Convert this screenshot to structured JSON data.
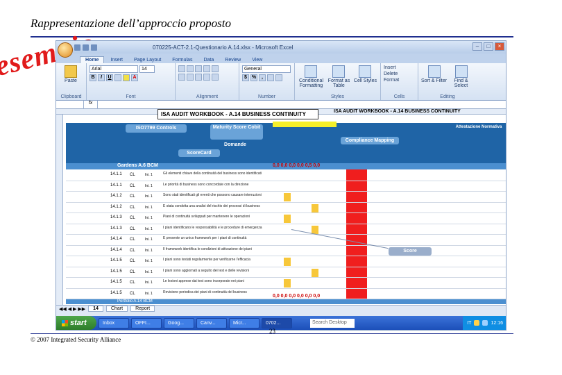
{
  "slide": {
    "title": "Rappresentazione dell’approccio proposto",
    "stamp": "esempio",
    "copyright": "© 2007 Integrated Security Alliance",
    "page_number": "23",
    "accent_color": "#e11b1b",
    "rule_color": "#1f2f8f"
  },
  "excel": {
    "window_title": "070225-ACT-2.1-Questionario A.14.xlsx - Microsoft Excel",
    "tabs": [
      "Home",
      "Insert",
      "Page Layout",
      "Formulas",
      "Data",
      "Review",
      "View"
    ],
    "active_tab": "Home",
    "ribbon": {
      "clipboard": {
        "paste": "Paste",
        "label": "Clipboard"
      },
      "font": {
        "font_name": "Arial",
        "font_size": "14",
        "label": "Font"
      },
      "alignment": {
        "label": "Alignment"
      },
      "number": {
        "format": "General",
        "label": "Number"
      },
      "styles": {
        "conditional": "Conditional Formatting",
        "format_table": "Format as Table",
        "cell_styles": "Cell Styles",
        "label": "Styles"
      },
      "cells": {
        "insert": "Insert",
        "delete": "Delete",
        "format": "Format",
        "label": "Cells"
      },
      "editing": {
        "sort": "Sort & Filter",
        "find": "Find & Select",
        "label": "Editing"
      }
    },
    "sheet": {
      "banner": "ISA AUDIT WORKBOOK - A.14 BUSINESS CONTINUITY",
      "banner2": "ISA AUDIT WORKBOOK - A.14 BUSINESS CONTINUITY",
      "yellow_strip": "Maturity Score Area",
      "section_header": "Gardens A.6 BCM",
      "bottom_bar": "Portfolio A.14 BCM",
      "overlays": {
        "controls": "ISO7799 Controls",
        "maturity": "Maturity Score Cobit",
        "domande": "Domande",
        "scorecard": "ScoreCard",
        "compliance": "Compliance Mapping",
        "attestazione": "Attestazione Normativa"
      },
      "score_row_top": "0,0 0,0 0,0 0,0 0,5 0,0",
      "score_row_bottom": "0,0 0,0 0,0 0,0 0,0 0,0",
      "rows": [
        {
          "id": "14.1.1",
          "ref": "CL",
          "type": "Ini. 1",
          "text": "Gli elementi chiave della continuità del business sono identificati"
        },
        {
          "id": "14.1.1",
          "ref": "CL",
          "type": "Ini. 1",
          "text": "Le priorità di business sono concordate con la direzione"
        },
        {
          "id": "14.1.2",
          "ref": "CL",
          "type": "Ini. 1",
          "text": "Sono stati identificati gli eventi che possono causare interruzioni"
        },
        {
          "id": "14.1.2",
          "ref": "CL",
          "type": "Ini. 1",
          "text": "È stata condotta una analisi del rischio dei processi di business"
        },
        {
          "id": "14.1.3",
          "ref": "CL",
          "type": "Ini. 1",
          "text": "Piani di continuità sviluppati per mantenere le operazioni"
        },
        {
          "id": "14.1.3",
          "ref": "CL",
          "type": "Ini. 1",
          "text": "I piani identificano le responsabilità e le procedure di emergenza"
        },
        {
          "id": "14.1.4",
          "ref": "CL",
          "type": "Ini. 1",
          "text": "È presente un unico framework per i piani di continuità"
        },
        {
          "id": "14.1.4",
          "ref": "CL",
          "type": "Ini. 1",
          "text": "Il framework identifica le condizioni di attivazione dei piani"
        },
        {
          "id": "14.1.5",
          "ref": "CL",
          "type": "Ini. 1",
          "text": "I piani sono testati regolarmente per verificarne l'efficacia"
        },
        {
          "id": "14.1.5",
          "ref": "CL",
          "type": "Ini. 1",
          "text": "I piani sono aggiornati a seguito dei test e delle revisioni"
        },
        {
          "id": "14.1.5",
          "ref": "CL",
          "type": "Ini. 1",
          "text": "Le lezioni apprese dai test sono incorporate nei piani"
        },
        {
          "id": "14.1.5",
          "ref": "CL",
          "type": "Ini. 1",
          "text": "Revisione periodica dei piani di continuità del business"
        }
      ],
      "callout_score": "Score"
    },
    "sheet_tabs": [
      "14",
      "Chart",
      "Report"
    ],
    "active_sheet_tab": "14",
    "taskbar": {
      "start": "start",
      "items": [
        "Inbox",
        "OFFI...",
        "Goog...",
        "Canv...",
        "Micr...",
        "0702..."
      ],
      "search": "Search Desktop",
      "lang": "IT",
      "clock": "12:16"
    }
  }
}
